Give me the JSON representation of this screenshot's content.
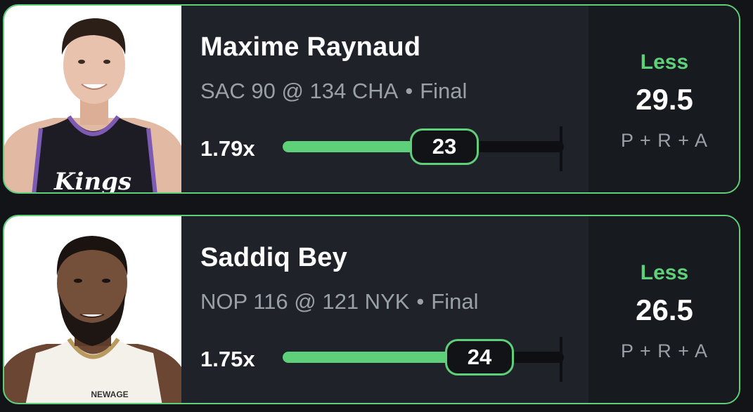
{
  "accent_color": "#5fd07a",
  "cards": [
    {
      "player_name": "Maxime Raynaud",
      "game": "SAC 90 @ 134 CHA",
      "status": "Final",
      "multiplier": "1.79x",
      "actual": "23",
      "pick": "Less",
      "line": "29.5",
      "stat": "P + R + A",
      "progress_fraction": 0.575,
      "jersey_text": "Kings"
    },
    {
      "player_name": "Saddiq Bey",
      "game": "NOP 116 @ 121 NYK",
      "status": "Final",
      "multiplier": "1.75x",
      "actual": "24",
      "pick": "Less",
      "line": "26.5",
      "stat": "P + R + A",
      "progress_fraction": 0.7,
      "jersey_text": "NEWAGE"
    }
  ]
}
